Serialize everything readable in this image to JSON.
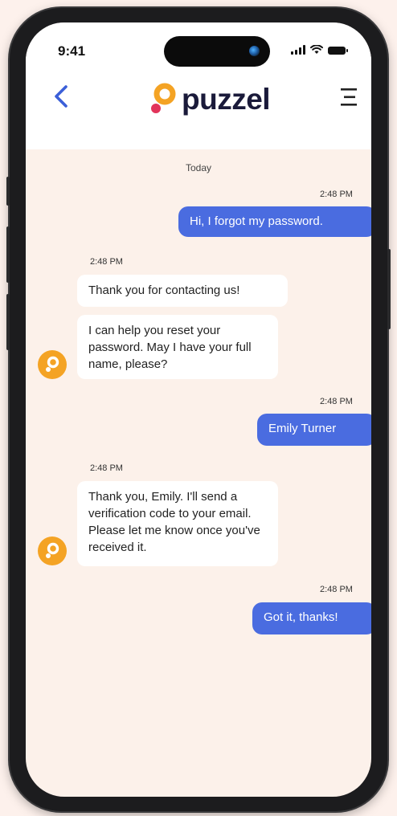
{
  "status_bar": {
    "time": "9:41"
  },
  "header": {
    "brand": "puzzel"
  },
  "chat": {
    "day_label": "Today",
    "messages": [
      {
        "from": "user",
        "time": "2:48 PM",
        "text": "Hi, I forgot my password."
      },
      {
        "from": "agent",
        "time": "2:48 PM",
        "text": "Thank you for contacting us!"
      },
      {
        "from": "agent",
        "text": "I can help you reset your password. May I have your full name, please?"
      },
      {
        "from": "user",
        "time": "2:48 PM",
        "text": "Emily Turner"
      },
      {
        "from": "agent",
        "time": "2:48 PM",
        "text": "Thank you, Emily. I'll send a verification code to your email. Please let me know once you've received it."
      },
      {
        "from": "user",
        "time": "2:48 PM",
        "text": "Got it, thanks!"
      }
    ]
  },
  "colors": {
    "accent": "#4a6ce0",
    "avatar": "#f4a324",
    "background": "#fcf1ea"
  },
  "icons": {
    "back": "chevron-left-icon",
    "menu": "menu-icon",
    "avatar": "puzzel-logo-icon"
  }
}
